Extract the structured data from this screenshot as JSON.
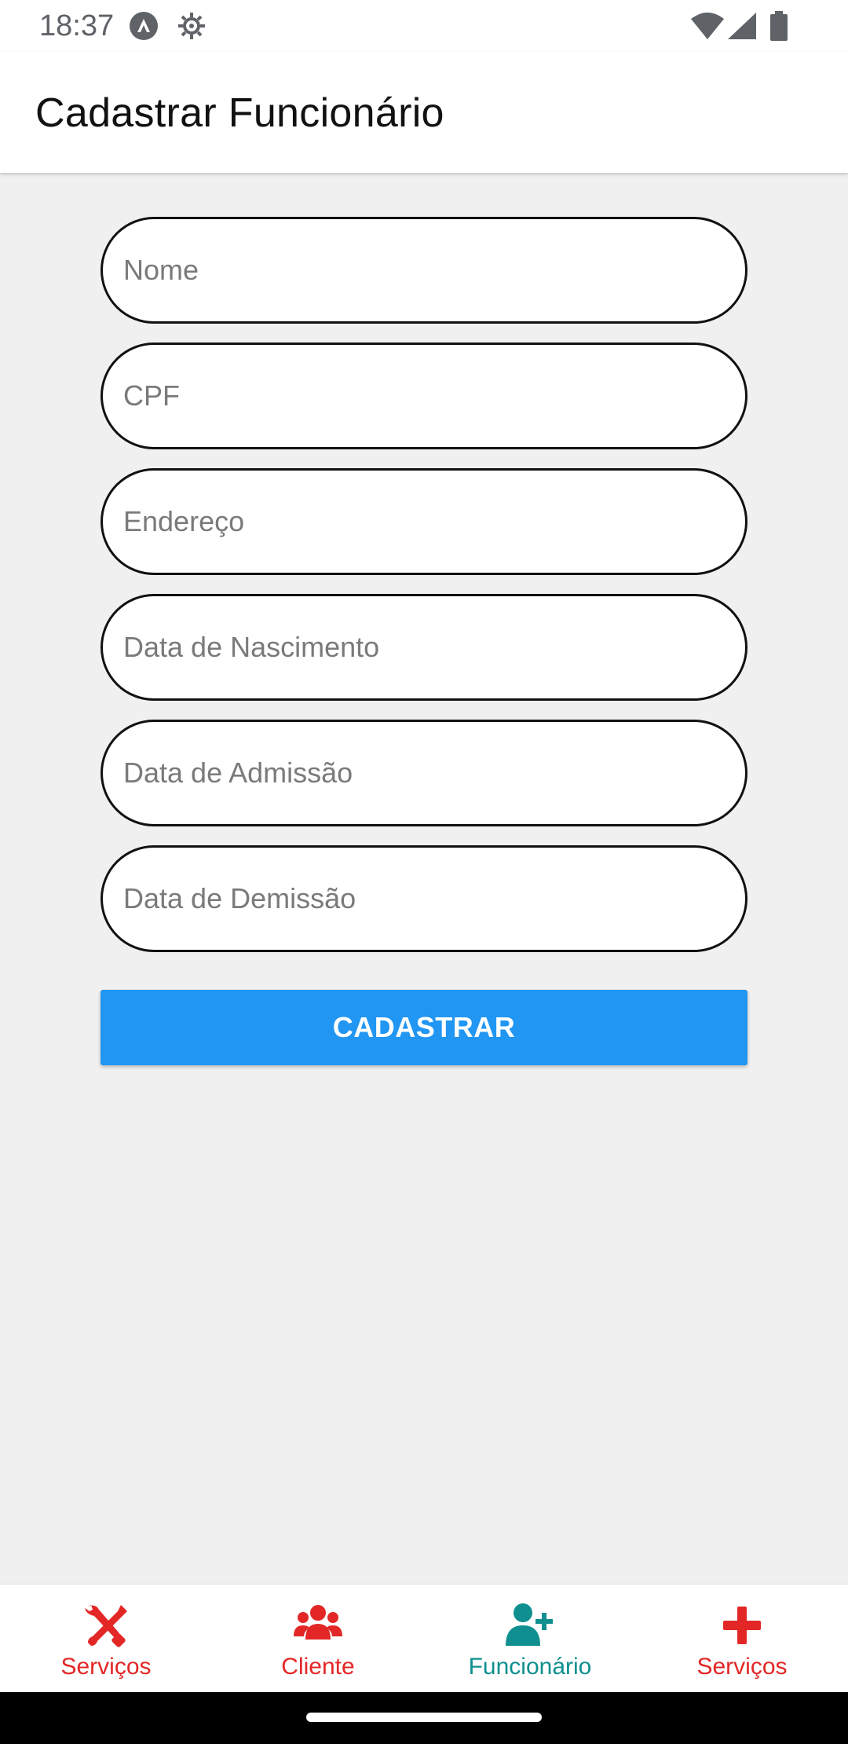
{
  "status_bar": {
    "time": "18:37",
    "icons": [
      "a-badge-icon",
      "gear-icon",
      "wifi-icon",
      "signal-icon",
      "battery-icon"
    ]
  },
  "app_bar": {
    "title": "Cadastrar Funcionário"
  },
  "form": {
    "fields": [
      {
        "placeholder": "Nome",
        "value": ""
      },
      {
        "placeholder": "CPF",
        "value": ""
      },
      {
        "placeholder": "Endereço",
        "value": ""
      },
      {
        "placeholder": "Data de Nascimento",
        "value": ""
      },
      {
        "placeholder": "Data de Admissão",
        "value": ""
      },
      {
        "placeholder": "Data de Demissão",
        "value": ""
      }
    ],
    "submit_label": "CADASTRAR"
  },
  "bottom_nav": {
    "items": [
      {
        "label": "Serviços",
        "icon": "tools-icon",
        "active": false
      },
      {
        "label": "Cliente",
        "icon": "users-icon",
        "active": false
      },
      {
        "label": "Funcionário",
        "icon": "user-plus-icon",
        "active": true
      },
      {
        "label": "Serviços",
        "icon": "plus-icon",
        "active": false
      }
    ]
  },
  "colors": {
    "accent": "#2196f3",
    "nav_inactive": "#e32727",
    "nav_active": "#0f8f8f",
    "background": "#f0f0f0"
  }
}
